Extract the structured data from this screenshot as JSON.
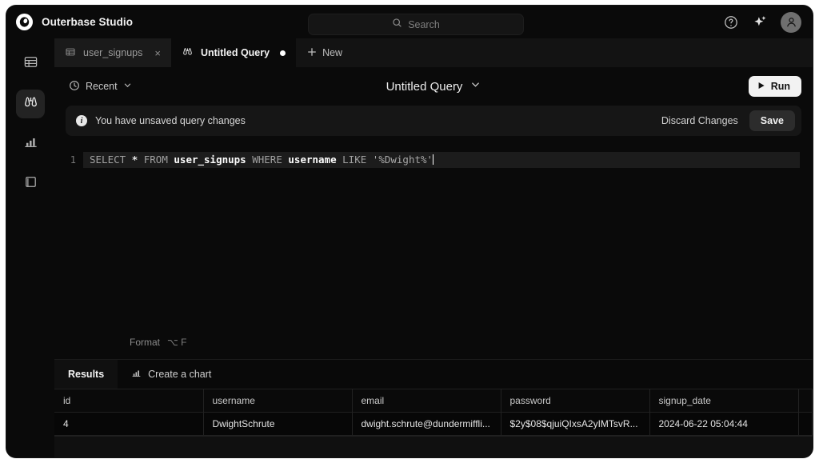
{
  "app": {
    "name": "Outerbase Studio",
    "logo_icon": "outerbase-logo-icon"
  },
  "search": {
    "placeholder": "Search",
    "icon": "search-icon"
  },
  "titlebar_actions": {
    "help_icon": "help-circle-icon",
    "ai_icon": "sparkles-icon",
    "avatar_icon": "user-avatar-icon"
  },
  "sidebar": {
    "items": [
      {
        "id": "tables",
        "icon": "table-icon",
        "active": false
      },
      {
        "id": "query",
        "icon": "binoculars-icon",
        "active": true
      },
      {
        "id": "charts",
        "icon": "bar-chart-icon",
        "active": false
      },
      {
        "id": "docs",
        "icon": "book-icon",
        "active": false
      }
    ]
  },
  "tabs": {
    "items": [
      {
        "label": "user_signups",
        "icon": "table-icon",
        "active": false,
        "close_label": "×"
      },
      {
        "label": "Untitled Query",
        "icon": "binoculars-icon",
        "active": true,
        "dirty": true
      }
    ],
    "new_label": "New",
    "new_icon": "plus-icon"
  },
  "toolbar": {
    "recent_label": "Recent",
    "recent_icon": "clock-icon",
    "recent_chevron_icon": "chevron-down-icon",
    "query_title": "Untitled Query",
    "query_chevron_icon": "chevron-down-icon",
    "run_label": "Run",
    "run_icon": "play-icon"
  },
  "banner": {
    "icon": "info-icon",
    "info_glyph": "i",
    "message": "You have unsaved query changes",
    "discard_label": "Discard Changes",
    "save_label": "Save"
  },
  "editor": {
    "line_number": "1",
    "sql_plain": "SELECT * FROM user_signups WHERE username LIKE '%Dwight%'",
    "tokens": [
      {
        "text": "SELECT",
        "type": "kw"
      },
      {
        "text": " ",
        "type": "plain"
      },
      {
        "text": "*",
        "type": "op"
      },
      {
        "text": " ",
        "type": "plain"
      },
      {
        "text": "FROM",
        "type": "kw"
      },
      {
        "text": " ",
        "type": "plain"
      },
      {
        "text": "user_signups",
        "type": "id"
      },
      {
        "text": " ",
        "type": "plain"
      },
      {
        "text": "WHERE",
        "type": "kw"
      },
      {
        "text": " ",
        "type": "plain"
      },
      {
        "text": "username",
        "type": "id"
      },
      {
        "text": " ",
        "type": "plain"
      },
      {
        "text": "LIKE",
        "type": "kw"
      },
      {
        "text": " ",
        "type": "plain"
      },
      {
        "text": "'%Dwight%'",
        "type": "str"
      }
    ],
    "format_label": "Format",
    "format_shortcut": "⌥ F"
  },
  "results": {
    "tabs": [
      {
        "label": "Results",
        "icon": null,
        "active": true
      },
      {
        "label": "Create a chart",
        "icon": "bar-chart-icon",
        "active": false
      }
    ],
    "columns": [
      "id",
      "username",
      "email",
      "password",
      "signup_date"
    ],
    "rows": [
      {
        "id": "4",
        "username": "DwightSchrute",
        "email": "dwight.schrute@dundermiffli...",
        "password": "$2y$08$qjuiQIxsA2yIMTsvR...",
        "signup_date": "2024-06-22 05:04:44"
      }
    ]
  },
  "colors": {
    "app_background": "#0a0a0a",
    "panel_background": "#0d0d0d",
    "accent_text": "#ffffff",
    "muted_text": "#8b8b8b",
    "active_rail": "#232323",
    "run_button": "#f2f2f2"
  }
}
